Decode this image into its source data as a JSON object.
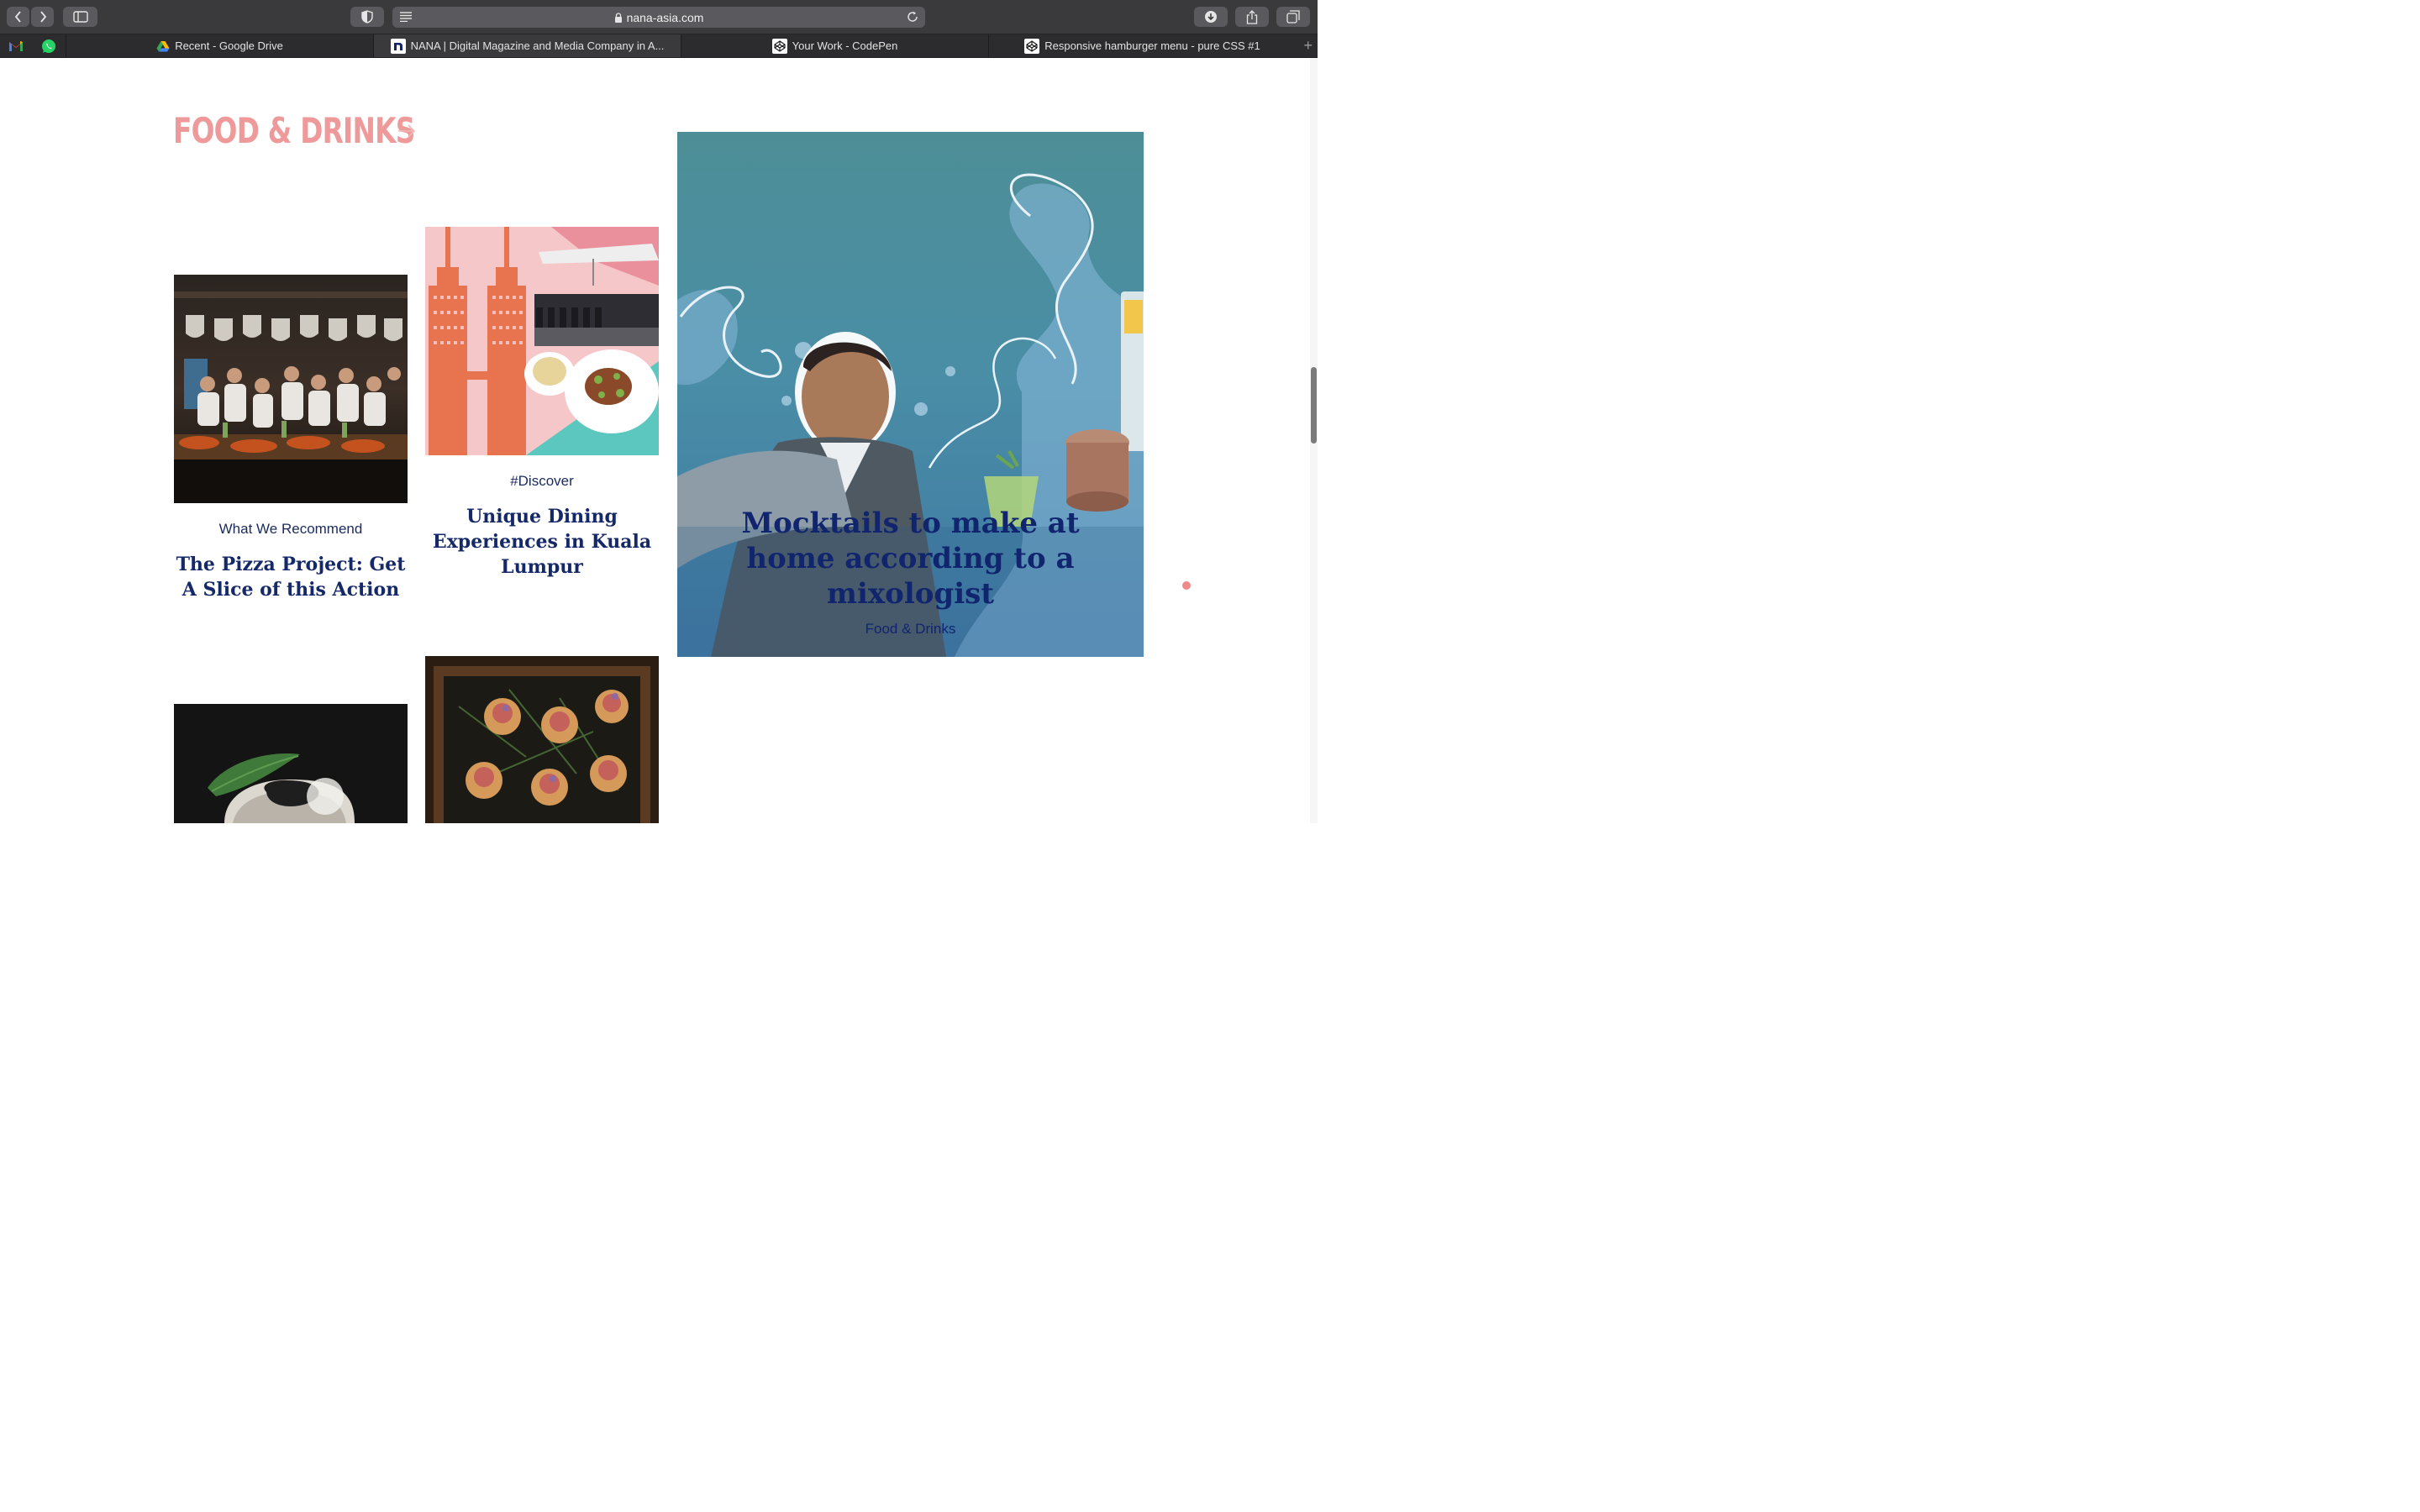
{
  "browser": {
    "url": "nana-asia.com",
    "tabs": [
      {
        "label": "Recent - Google Drive",
        "icon": "google-drive-icon",
        "active": false
      },
      {
        "label": "NANA | Digital Magazine and Media Company in A...",
        "icon": "nana-icon",
        "active": true
      },
      {
        "label": "Your Work - CodePen",
        "icon": "codepen-icon",
        "active": false
      },
      {
        "label": "Responsive hamburger menu - pure CSS #1",
        "icon": "codepen-icon",
        "active": false
      }
    ],
    "pinned": [
      "gmail-icon",
      "whatsapp-icon"
    ]
  },
  "section": {
    "title": "FOOD & DRINKS",
    "accent_color": "#ee9a9a"
  },
  "cards": [
    {
      "category": "What We Recommend",
      "title": "The Pizza Project: Get A Slice of this Action"
    },
    {
      "category": "#Discover",
      "title": "Unique Dining Experiences in Kuala Lumpur"
    }
  ],
  "feature": {
    "title": "Mocktails to make at home according to a mixologist",
    "category": "Food & Drinks",
    "title_color": "#10256e"
  }
}
